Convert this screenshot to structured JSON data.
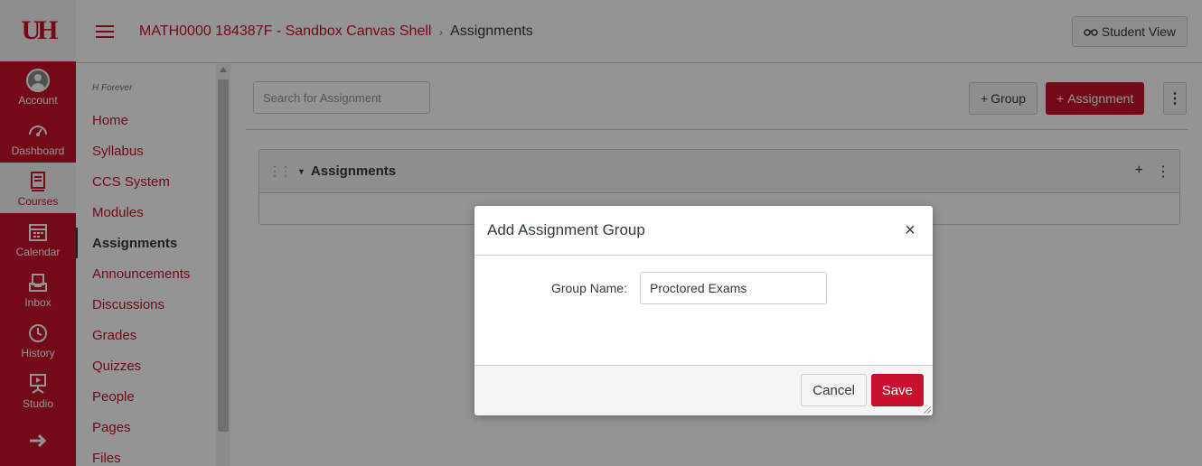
{
  "logo": {
    "text": "UH"
  },
  "global_nav": {
    "items": [
      {
        "label": "Account",
        "icon": "account-icon"
      },
      {
        "label": "Dashboard",
        "icon": "dashboard-icon"
      },
      {
        "label": "Courses",
        "icon": "courses-icon"
      },
      {
        "label": "Calendar",
        "icon": "calendar-icon"
      },
      {
        "label": "Inbox",
        "icon": "inbox-icon"
      },
      {
        "label": "History",
        "icon": "history-icon"
      },
      {
        "label": "Studio",
        "icon": "studio-icon"
      }
    ]
  },
  "header": {
    "breadcrumb_course": "MATH0000 184387F - Sandbox Canvas Shell",
    "breadcrumb_sep": "›",
    "breadcrumb_current": "Assignments",
    "student_view_icon": "glasses-icon",
    "student_view_label": "Student View"
  },
  "course_nav": {
    "subtitle": "H Forever",
    "items": [
      "Home",
      "Syllabus",
      "CCS System",
      "Modules",
      "Assignments",
      "Announcements",
      "Discussions",
      "Grades",
      "Quizzes",
      "People",
      "Pages",
      "Files"
    ],
    "active": "Assignments"
  },
  "toolbar": {
    "search_placeholder": "Search for Assignment",
    "group_button_plus": "+",
    "group_button_label": "Group",
    "assignment_button_plus": "+",
    "assignment_button_label": "Assignment",
    "kebab": "⋮"
  },
  "assignment_group": {
    "drag": "⋮⋮",
    "caret": "▼",
    "title": "Assignments",
    "add": "+",
    "menu": "⋮"
  },
  "modal": {
    "title": "Add Assignment Group",
    "close": "×",
    "field_label": "Group Name:",
    "field_value": "Proctored Exams",
    "cancel_label": "Cancel",
    "save_label": "Save"
  },
  "colors": {
    "brand": "#c8102e",
    "overlay": "rgba(0,0,0,0.42)"
  }
}
